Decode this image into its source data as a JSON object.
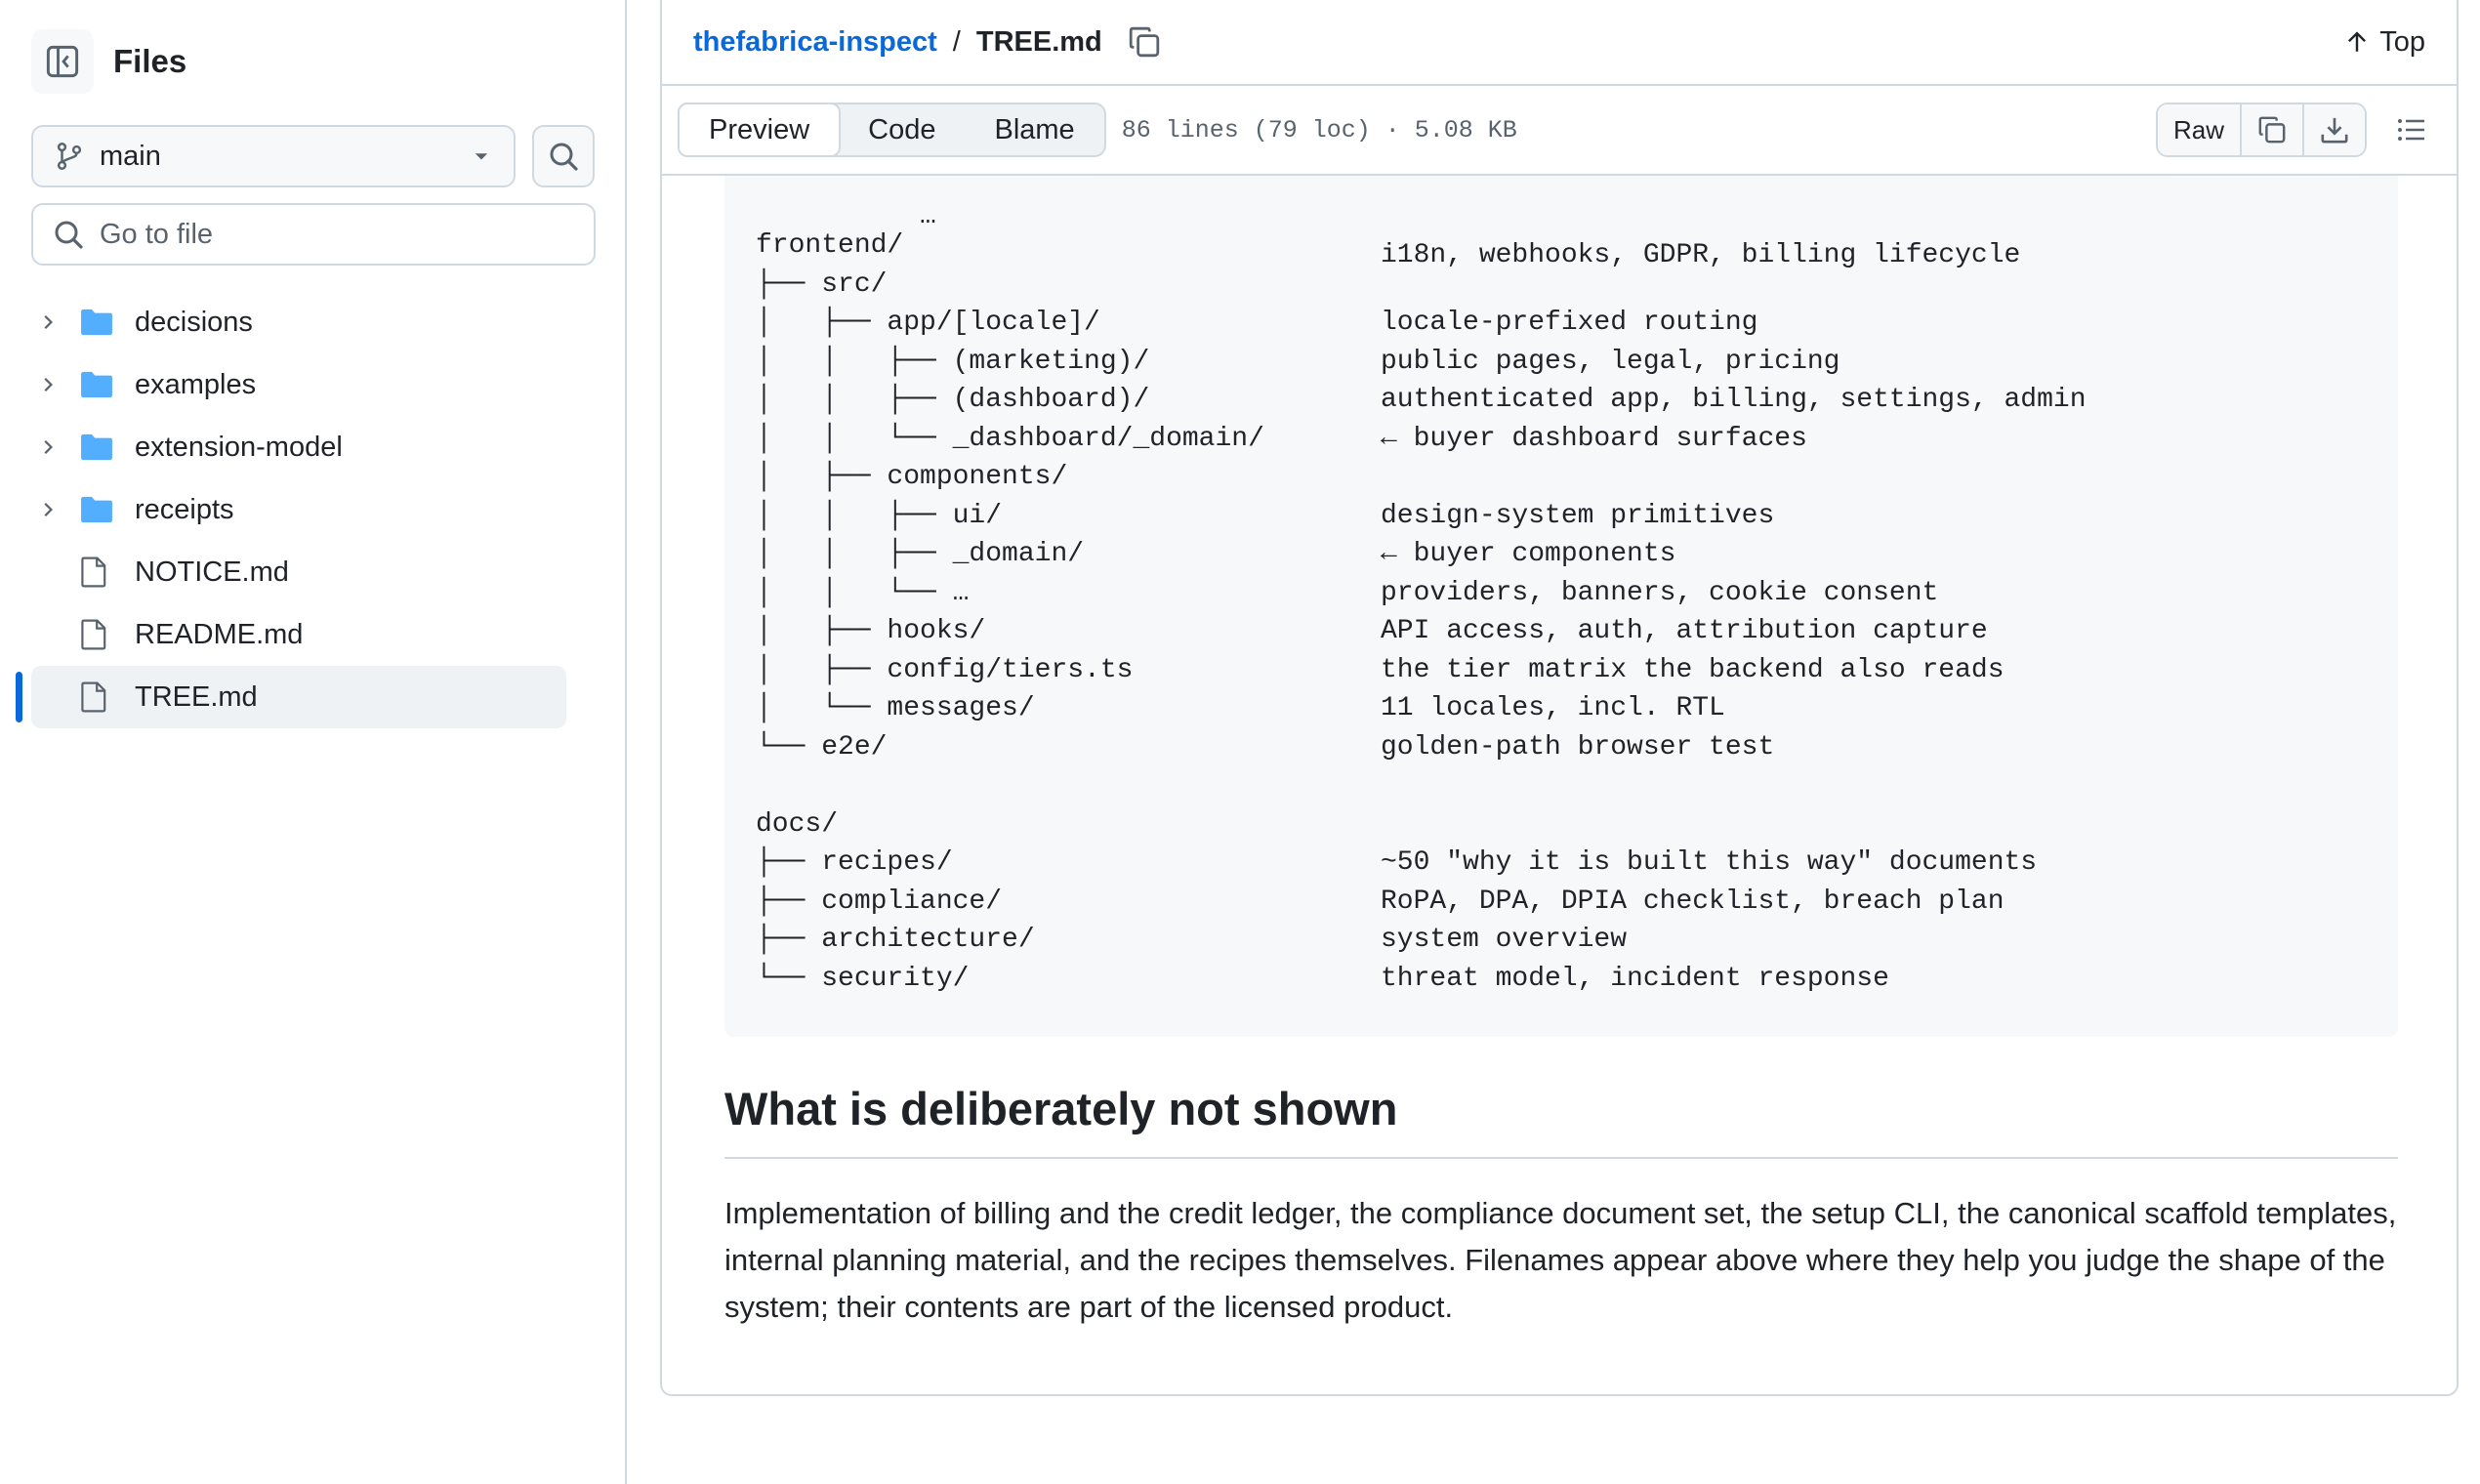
{
  "sidebar": {
    "title": "Files",
    "branch": "main",
    "goto_placeholder": "Go to file",
    "items": [
      {
        "label": "decisions",
        "type": "folder"
      },
      {
        "label": "examples",
        "type": "folder"
      },
      {
        "label": "extension-model",
        "type": "folder"
      },
      {
        "label": "receipts",
        "type": "folder"
      },
      {
        "label": "NOTICE.md",
        "type": "file"
      },
      {
        "label": "README.md",
        "type": "file"
      },
      {
        "label": "TREE.md",
        "type": "file",
        "active": true
      }
    ]
  },
  "header": {
    "repo": "thefabrica-inspect",
    "separator": "/",
    "file": "TREE.md",
    "top_label": "Top"
  },
  "toolbar": {
    "tabs": [
      "Preview",
      "Code",
      "Blame"
    ],
    "selected_tab": "Preview",
    "meta": "86 lines (79 loc) · 5.08 KB",
    "raw_label": "Raw"
  },
  "code": {
    "partial_top": [
      "  …",
      "i18n, webhooks, GDPR, billing lifecycle"
    ],
    "lines": [
      [
        "frontend/",
        ""
      ],
      [
        "├── src/",
        ""
      ],
      [
        "│   ├── app/[locale]/",
        "locale-prefixed routing"
      ],
      [
        "│   │   ├── (marketing)/",
        "public pages, legal, pricing"
      ],
      [
        "│   │   ├── (dashboard)/",
        "authenticated app, billing, settings, admin"
      ],
      [
        "│   │   └── _dashboard/_domain/",
        "← buyer dashboard surfaces"
      ],
      [
        "│   ├── components/",
        ""
      ],
      [
        "│   │   ├── ui/",
        "design-system primitives"
      ],
      [
        "│   │   ├── _domain/",
        "← buyer components"
      ],
      [
        "│   │   └── …",
        "providers, banners, cookie consent"
      ],
      [
        "│   ├── hooks/",
        "API access, auth, attribution capture"
      ],
      [
        "│   ├── config/tiers.ts",
        "the tier matrix the backend also reads"
      ],
      [
        "│   └── messages/",
        "11 locales, incl. RTL"
      ],
      [
        "└── e2e/",
        "golden-path browser test"
      ],
      [
        "",
        ""
      ],
      [
        "docs/",
        ""
      ],
      [
        "├── recipes/",
        "~50 \"why it is built this way\" documents"
      ],
      [
        "├── compliance/",
        "RoPA, DPA, DPIA checklist, breach plan"
      ],
      [
        "├── architecture/",
        "system overview"
      ],
      [
        "└── security/",
        "threat model, incident response"
      ]
    ]
  },
  "section": {
    "heading": "What is deliberately not shown",
    "paragraph": "Implementation of billing and the credit ledger, the compliance document set, the setup CLI, the canonical scaffold templates, internal planning material, and the recipes themselves. Filenames appear above where they help you judge the shape of the system; their contents are part of the licensed product."
  },
  "icons": {
    "folder_color": "#54aeff",
    "link_color": "#0969da",
    "active_marker_color": "#0969da"
  }
}
